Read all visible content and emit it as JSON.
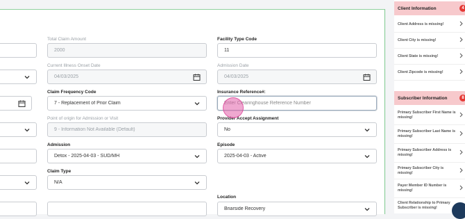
{
  "form": {
    "total_claim_amount": {
      "label": "Total Claim Amount",
      "value": "2000"
    },
    "facility_type_code": {
      "label": "Facility Type Code",
      "value": "11"
    },
    "current_illness_onset_date": {
      "label": "Current Illness Onset Date",
      "value": "04/03/2025"
    },
    "admission_date": {
      "label": "Admission Date",
      "value": "04/03/2025"
    },
    "claim_frequency_code": {
      "label": "Claim Frequency Code",
      "value": "7 - Replacement of Prior Claim"
    },
    "insurance_reference": {
      "label": "Insurance Reference#:",
      "placeholder": "Enter Clearinghouse Reference Number"
    },
    "point_of_origin": {
      "label": "Point of origin for Admission or Visit",
      "value": "9 - Information Not Available (Default)"
    },
    "provider_accept_assignment": {
      "label": "Provider Accept Assignment",
      "value": "No"
    },
    "admission": {
      "label": "Admission",
      "value": "Detox - 2025-04-03 - SUD/MH"
    },
    "episode": {
      "label": "Episode",
      "value": "2025-04-03 - Active"
    },
    "claim_type": {
      "label": "Claim Type",
      "value": "N/A"
    },
    "location": {
      "label": "Location",
      "value": "Briarside Recovery"
    }
  },
  "sidebar": {
    "client_info": {
      "title": "Client Information",
      "count": "4",
      "items": [
        "Client Address is missing!",
        "Client City is missing!",
        "Client State is missing!",
        "Client Zipcode is missing!"
      ]
    },
    "subscriber_info": {
      "title": "Subscriber Information",
      "count": "8",
      "items": [
        "Primary Subscriber First Name is missing!",
        "Primary Subscriber Last Name is missing!",
        "Primary Subscriber Address is missing!",
        "Primary Subscriber City is missing!",
        "Payer Member ID Number is missing!",
        "Client Relationship to Primary Subscriber is missing!"
      ]
    }
  },
  "colors": {
    "accent_green": "#8fd19e",
    "alert_red": "#e53935",
    "section_pink": "#f7c9cc"
  }
}
